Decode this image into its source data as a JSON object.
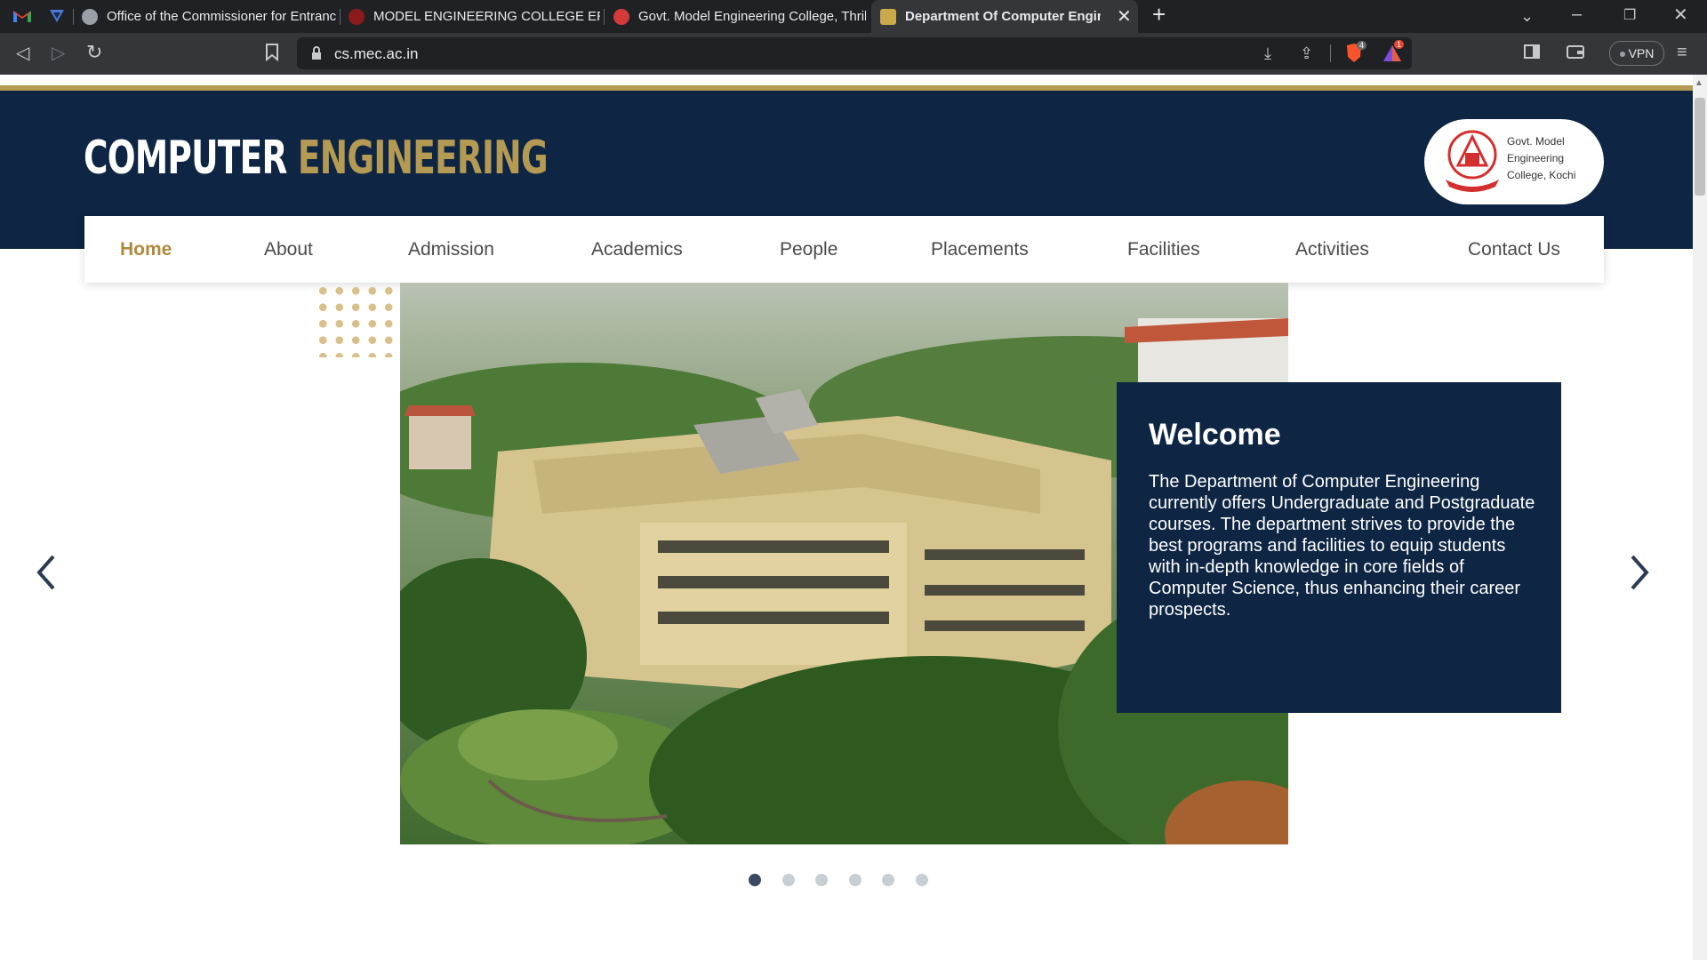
{
  "browser": {
    "tabs": [
      {
        "title": "Office of the Commissioner for Entrance Examinations"
      },
      {
        "title": "MODEL ENGINEERING COLLEGE ERNAKULAM"
      },
      {
        "title": "Govt. Model Engineering College, Thrikkakara"
      },
      {
        "title": "Department Of Computer Engineering",
        "active": true
      }
    ],
    "url": "cs.mec.ac.in",
    "brave_shield_count": "4",
    "rewards_count": "1",
    "vpn_label": "VPN"
  },
  "site": {
    "brand_white": "COMPUTER",
    "brand_gold": "ENGINEERING",
    "logo_text": "Govt. Model Engineering College, Kochi",
    "accent_gold": "#b59a53",
    "navy": "#0e2544"
  },
  "nav": {
    "items": [
      "Home",
      "About",
      "Admission",
      "Academics",
      "People",
      "Placements",
      "Facilities",
      "Activities",
      "Contact Us"
    ],
    "active": "Home"
  },
  "hero": {
    "heading": "Welcome",
    "body": "The Department of Computer Engineering currently offers Undergraduate and Postgraduate courses. The department strives to provide the best programs and facilities to equip students with in-depth knowledge in core fields of Computer Science, thus enhancing their career prospects.",
    "slide_count": 6,
    "current_slide": 1
  },
  "icons": {
    "back": "arrow-left-icon",
    "forward": "arrow-right-icon",
    "reload": "reload-icon",
    "bookmark": "bookmark-icon",
    "lock": "lock-icon",
    "prev_slide": "chevron-left-icon",
    "next_slide": "chevron-right-icon"
  }
}
